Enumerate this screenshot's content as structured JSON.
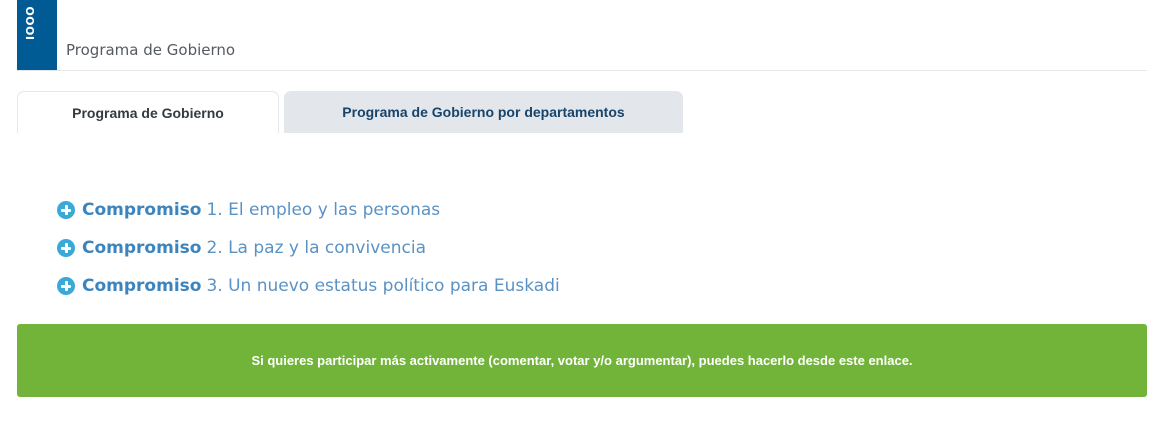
{
  "header": {
    "logo_text": "IOOO",
    "title": "Programa de Gobierno"
  },
  "tabs": [
    {
      "label": "Programa de Gobierno",
      "active": true
    },
    {
      "label": "Programa de Gobierno por departamentos",
      "active": false
    }
  ],
  "commitments": [
    {
      "prefix": "Compromiso",
      "text": "1. El empleo y las personas"
    },
    {
      "prefix": "Compromiso",
      "text": "2. La paz y la convivencia"
    },
    {
      "prefix": "Compromiso",
      "text": "3. Un nuevo estatus político para Euskadi"
    }
  ],
  "banner": {
    "text": "Si quieres participar más activamente (comentar, votar y/o argumentar), puedes hacerlo desde este enlace."
  },
  "colors": {
    "brand_blue": "#005a94",
    "link_blue": "#3b84be",
    "icon_blue": "#3aa9d8",
    "tab_inactive_bg": "#e3e6ea",
    "banner_green": "#72b43a"
  },
  "icons": {
    "commitment_expand": "plus-circle-icon"
  }
}
